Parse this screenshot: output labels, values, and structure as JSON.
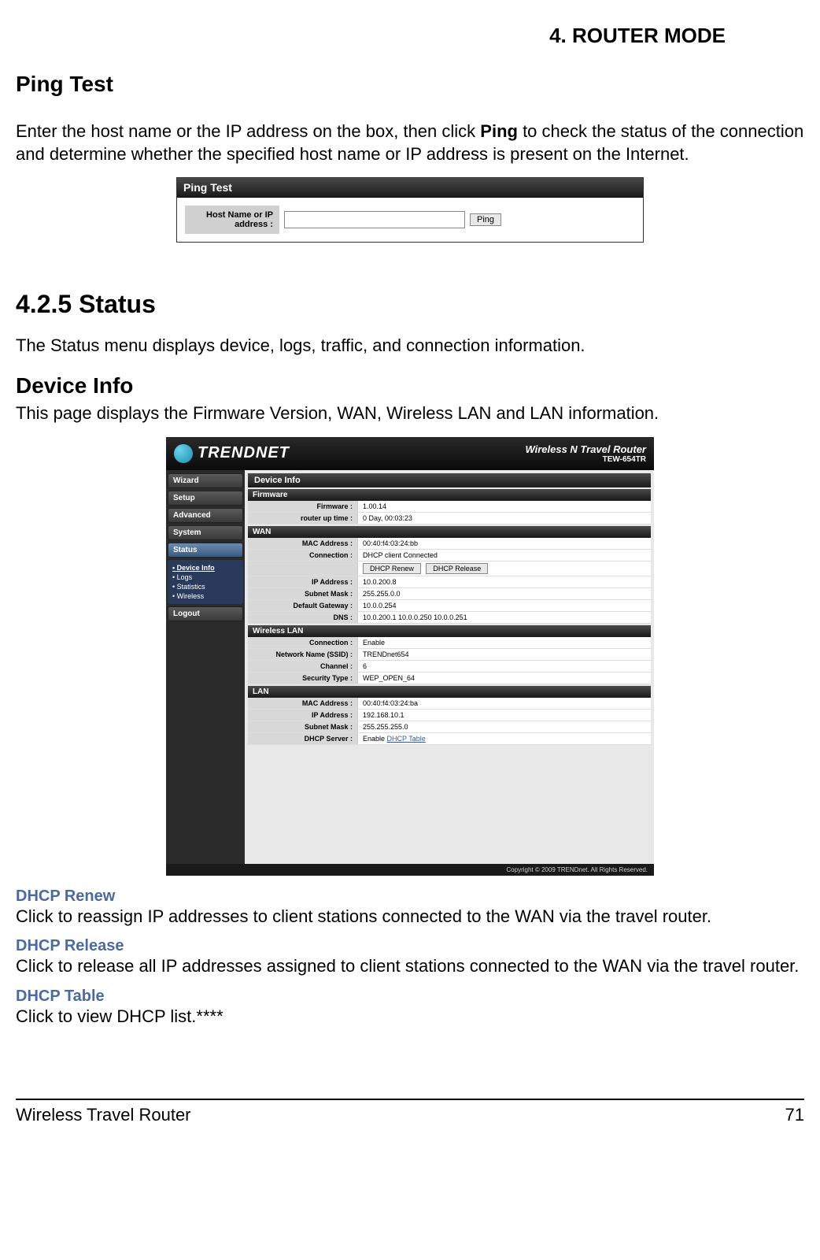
{
  "chapter": "4.  ROUTER MODE",
  "ping_section": {
    "title": "Ping Test",
    "description_pre": "Enter the host name or the IP address on the box, then click ",
    "description_bold": "Ping",
    "description_post": " to check the status of the connection and determine whether the specified host name or IP address is present on the Internet.",
    "panel_title": "Ping Test",
    "field_label": "Host Name or IP address :",
    "button_label": "Ping"
  },
  "status_section": {
    "title": "4.2.5 Status",
    "description": "The Status menu displays device, logs, traffic, and connection information."
  },
  "device_info_section": {
    "title": "Device Info",
    "description": "This page displays the Firmware Version, WAN, Wireless LAN and LAN information."
  },
  "admin_ui": {
    "brand": "TRENDNET",
    "product_name": "Wireless N Travel Router",
    "model": "TEW-654TR",
    "nav": [
      "Wizard",
      "Setup",
      "Advanced",
      "System",
      "Status"
    ],
    "submenu": [
      "Device Info",
      "Logs",
      "Statistics",
      "Wireless"
    ],
    "logout": "Logout",
    "panel_title": "Device Info",
    "sections": {
      "firmware": {
        "header": "Firmware",
        "rows": [
          {
            "label": "Firmware :",
            "value": "1.00.14"
          },
          {
            "label": "router up time :",
            "value": "0 Day, 00:03:23"
          }
        ]
      },
      "wan": {
        "header": "WAN",
        "rows": [
          {
            "label": "MAC Address :",
            "value": "00:40:f4:03:24:bb"
          },
          {
            "label": "Connection :",
            "value": "DHCP client Connected"
          },
          {
            "label": "",
            "buttons": [
              "DHCP Renew",
              "DHCP Release"
            ]
          },
          {
            "label": "IP Address :",
            "value": "10.0.200.8"
          },
          {
            "label": "Subnet Mask :",
            "value": "255.255.0.0"
          },
          {
            "label": "Default Gateway :",
            "value": "10.0.0.254"
          },
          {
            "label": "DNS :",
            "value": "10.0.200.1 10.0.0.250 10.0.0.251"
          }
        ]
      },
      "wlan": {
        "header": "Wireless LAN",
        "rows": [
          {
            "label": "Connection :",
            "value": "Enable"
          },
          {
            "label": "Network Name (SSID) :",
            "value": "TRENDnet654"
          },
          {
            "label": "Channel :",
            "value": "6"
          },
          {
            "label": "Security Type :",
            "value": "WEP_OPEN_64"
          }
        ]
      },
      "lan": {
        "header": "LAN",
        "rows": [
          {
            "label": "MAC Address :",
            "value": "00:40:f4:03:24:ba"
          },
          {
            "label": "IP Address :",
            "value": "192.168.10.1"
          },
          {
            "label": "Subnet Mask :",
            "value": "255.255.255.0"
          },
          {
            "label": "DHCP Server :",
            "value": "Enable ",
            "link": "DHCP Table"
          }
        ]
      }
    },
    "copyright": "Copyright © 2009 TRENDnet. All Rights Reserved."
  },
  "definitions": {
    "dhcp_renew": {
      "term": "DHCP Renew",
      "text": "Click to reassign IP addresses to client stations connected to the WAN via the travel router."
    },
    "dhcp_release": {
      "term": "DHCP Release",
      "text": "Click to release all IP addresses assigned to client stations connected to the WAN via the travel router."
    },
    "dhcp_table": {
      "term": "DHCP Table",
      "text": "Click to view DHCP list.****"
    }
  },
  "footer": {
    "left": "Wireless Travel Router",
    "right": "71"
  }
}
